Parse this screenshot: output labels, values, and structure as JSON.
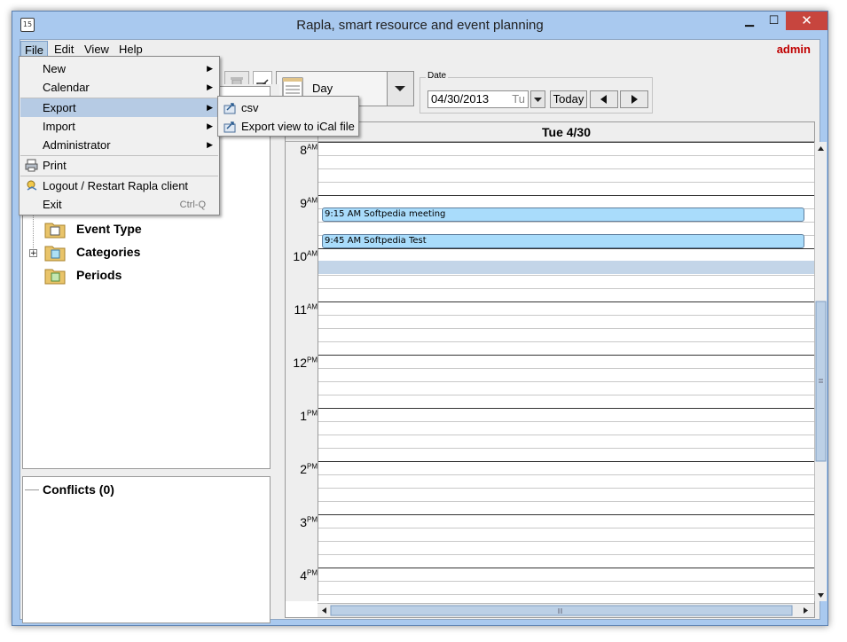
{
  "window": {
    "title": "Rapla, smart resource and event planning",
    "app_icon_text": "15",
    "minimize": "▁",
    "maximize": "☐",
    "close": "✕"
  },
  "menubar": {
    "items": [
      "File",
      "Edit",
      "View",
      "Help"
    ],
    "user": "admin"
  },
  "file_menu": {
    "items": [
      {
        "label": "New",
        "has_submenu": true
      },
      {
        "label": "Calendar",
        "has_submenu": true
      },
      {
        "label": "Export",
        "has_submenu": true
      },
      {
        "label": "Import",
        "has_submenu": true
      },
      {
        "label": "Administrator",
        "has_submenu": true
      },
      {
        "label": "Print",
        "icon": "print-icon"
      },
      {
        "label": "Logout / Restart Rapla client",
        "icon": "logout-icon"
      },
      {
        "label": "Exit",
        "shortcut": "Ctrl-Q"
      }
    ],
    "arrow": "▶"
  },
  "export_submenu": {
    "items": [
      {
        "label": "csv",
        "icon": "export-icon"
      },
      {
        "label": "Export view to iCal file",
        "icon": "export-icon"
      }
    ]
  },
  "tree": {
    "items": [
      {
        "label": "Event Type"
      },
      {
        "label": "Categories",
        "expander": "+"
      },
      {
        "label": "Periods"
      }
    ]
  },
  "conflicts": {
    "label": "Conflicts (0)"
  },
  "toolbar": {
    "view_label": "Day",
    "date_legend": "Date",
    "date_value": "04/30/2013",
    "date_weekday": "Tu",
    "today_label": "Today"
  },
  "calendar": {
    "day_header": "Tue 4/30",
    "hours": [
      {
        "num": "8",
        "ampm": "AM"
      },
      {
        "num": "9",
        "ampm": "AM"
      },
      {
        "num": "10",
        "ampm": "AM"
      },
      {
        "num": "11",
        "ampm": "AM"
      },
      {
        "num": "12",
        "ampm": "PM"
      },
      {
        "num": "1",
        "ampm": "PM"
      },
      {
        "num": "2",
        "ampm": "PM"
      },
      {
        "num": "3",
        "ampm": "PM"
      },
      {
        "num": "4",
        "ampm": "PM"
      }
    ],
    "events": [
      {
        "label": "9:15 AM Softpedia meeting"
      },
      {
        "label": "9:45 AM Softpedia Test"
      }
    ]
  },
  "colors": {
    "accent": "#b6cbe4",
    "event_fill": "#a9dcfb",
    "user": "#c00000",
    "close": "#c7453e"
  }
}
